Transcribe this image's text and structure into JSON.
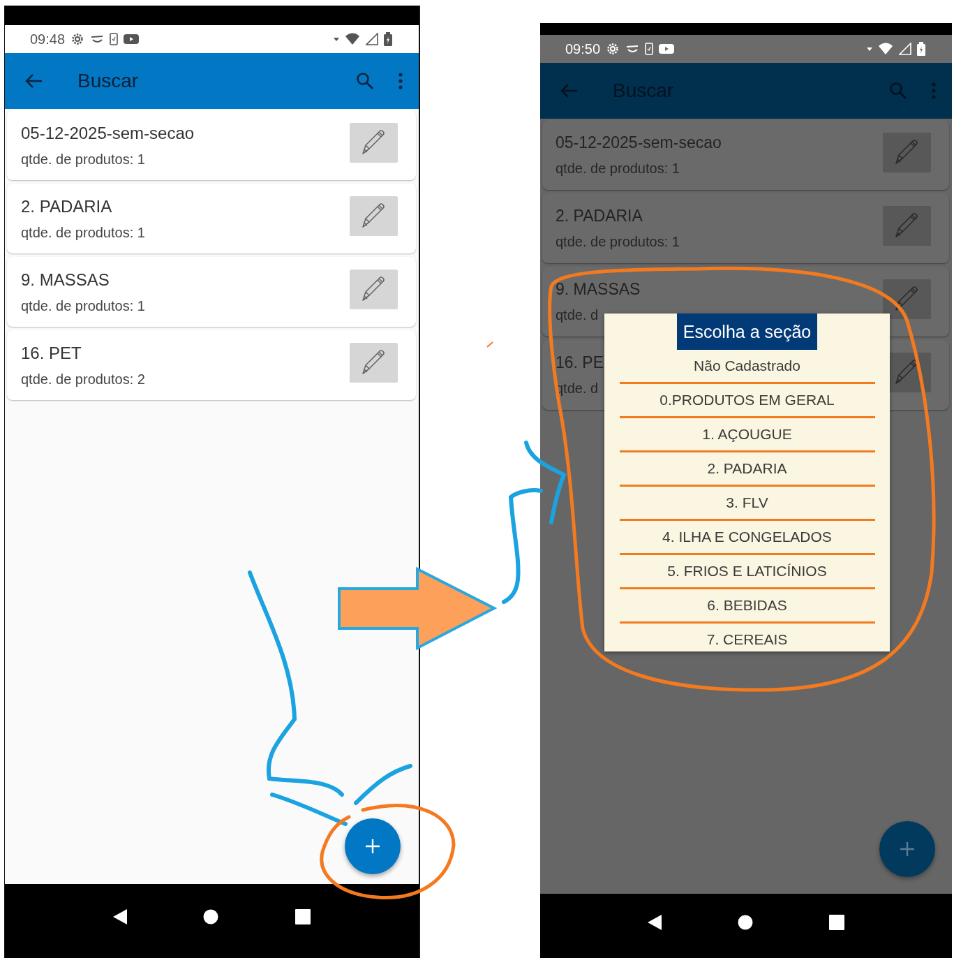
{
  "phones": [
    {
      "status_bar": {
        "time": "09:48"
      },
      "app_bar": {
        "title": "Buscar"
      },
      "dialog_open": false,
      "sections": [
        {
          "name": "05-12-2025-sem-secao",
          "count": "qtde. de produtos: 1"
        },
        {
          "name": "2. PADARIA",
          "count": "qtde. de produtos: 1"
        },
        {
          "name": "9. MASSAS",
          "count": "qtde. de produtos: 1"
        },
        {
          "name": "16. PET",
          "count": "qtde. de produtos: 2"
        }
      ]
    },
    {
      "status_bar": {
        "time": "09:50"
      },
      "app_bar": {
        "title": "Buscar"
      },
      "dialog_open": true,
      "sections": [
        {
          "name": "05-12-2025-sem-secao",
          "count": "qtde. de produtos: 1"
        },
        {
          "name": "2. PADARIA",
          "count": "qtde. de produtos: 1"
        },
        {
          "name": "9. MASSAS",
          "count": "qtde. d"
        },
        {
          "name": "16. PE",
          "count": "qtde. d"
        }
      ],
      "dialog": {
        "title": "Escolha a seção",
        "options": [
          "Não Cadastrado",
          "0.PRODUTOS EM GERAL",
          "1. AÇOUGUE",
          "2. PADARIA",
          "3. FLV",
          "4. ILHA E CONGELADOS",
          "5. FRIOS E LATICÍNIOS",
          "6. BEBIDAS",
          "7. CEREAIS"
        ]
      }
    }
  ]
}
